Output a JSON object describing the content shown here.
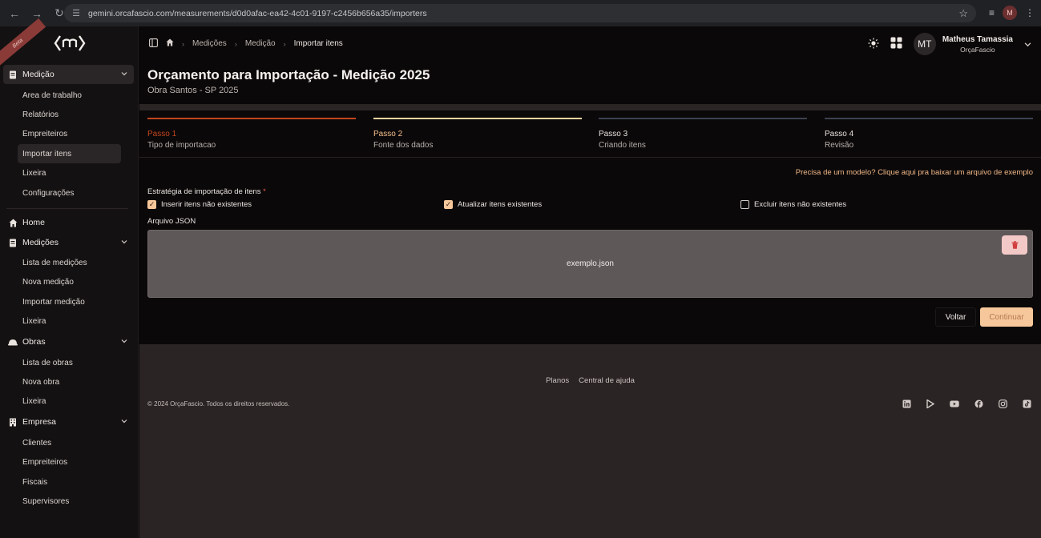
{
  "browser": {
    "url": "gemini.orcafascio.com/measurements/d0d0afac-ea42-4c01-9197-c2456b656a35/importers",
    "profile_initial": "M"
  },
  "sidebar": {
    "ribbon": "Beta",
    "section_medicao": {
      "label": "Medição",
      "items": [
        "Area de trabalho",
        "Relatórios",
        "Empreiteiros",
        "Importar itens",
        "Lixeira",
        "Configurações"
      ]
    },
    "home": "Home",
    "section_medicoes": {
      "label": "Medições",
      "items": [
        "Lista de medições",
        "Nova medição",
        "Importar medição",
        "Lixeira"
      ]
    },
    "section_obras": {
      "label": "Obras",
      "items": [
        "Lista de obras",
        "Nova obra",
        "Lixeira"
      ]
    },
    "section_empresa": {
      "label": "Empresa",
      "items": [
        "Clientes",
        "Empreiteiros",
        "Fiscais",
        "Supervisores"
      ]
    }
  },
  "topbar": {
    "breadcrumb": [
      "Medições",
      "Medição",
      "Importar itens"
    ],
    "user_initials": "MT",
    "user_name": "Matheus Tamassia",
    "user_company": "OrçaFascio"
  },
  "page": {
    "title": "Orçamento para Importação - Medição 2025",
    "subtitle": "Obra Santos - SP 2025"
  },
  "steps": [
    {
      "title": "Passo 1",
      "desc": "Tipo de importacao",
      "color": "#c2461e",
      "title_color": "#c2461e"
    },
    {
      "title": "Passo 2",
      "desc": "Fonte dos dados",
      "color": "#f5d49e",
      "title_color": "#f5c08e"
    },
    {
      "title": "Passo 3",
      "desc": "Criando itens",
      "color": "#3a4250",
      "title_color": "#e6e1de"
    },
    {
      "title": "Passo 4",
      "desc": "Revisão",
      "color": "#3a4250",
      "title_color": "#e6e1de"
    }
  ],
  "form": {
    "hint": "Precisa de um modelo? Clique aqui pra baixar um arquivo de exemplo",
    "strategy_label": "Estratégia de importação de itens",
    "required_mark": "*",
    "checkboxes": [
      {
        "label": "Inserir itens não existentes",
        "checked": true
      },
      {
        "label": "Atualizar itens existentes",
        "checked": true
      },
      {
        "label": "Excluir itens não existentes",
        "checked": false
      }
    ],
    "json_label": "Arquivo JSON",
    "file_name": "exemplo.json",
    "back": "Voltar",
    "next": "Continuar"
  },
  "footer": {
    "links": [
      "Planos",
      "Central de ajuda"
    ],
    "copyright": "© 2024 OrçaFascio. Todos os direitos reservados.",
    "social_icons": [
      "linkedin-icon",
      "play-icon",
      "youtube-icon",
      "facebook-icon",
      "instagram-icon",
      "tiktok-icon"
    ]
  },
  "colors": {
    "accent": "#f6c79b",
    "danger": "#d13d3d"
  }
}
